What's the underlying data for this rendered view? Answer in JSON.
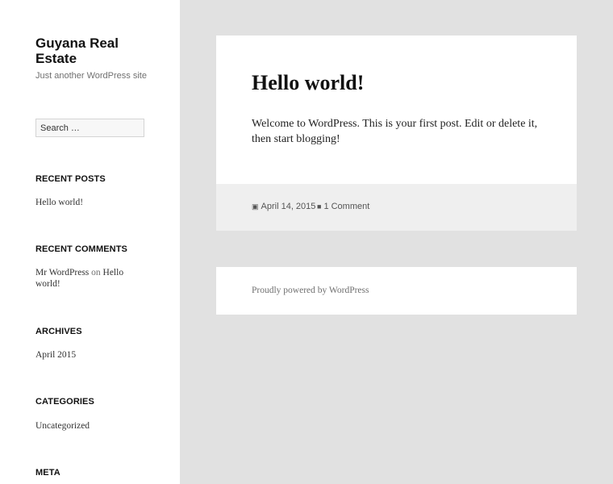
{
  "site": {
    "title": "Guyana Real Estate",
    "description": "Just another WordPress site"
  },
  "search": {
    "placeholder": "Search …"
  },
  "widgets": {
    "recent_posts": {
      "title": "RECENT POSTS",
      "items": [
        "Hello world!"
      ]
    },
    "recent_comments": {
      "title": "RECENT COMMENTS",
      "author": "Mr WordPress",
      "on": "on",
      "post": "Hello world!"
    },
    "archives": {
      "title": "ARCHIVES",
      "items": [
        "April 2015"
      ]
    },
    "categories": {
      "title": "CATEGORIES",
      "items": [
        "Uncategorized"
      ]
    },
    "meta": {
      "title": "META"
    }
  },
  "post": {
    "title": "Hello world!",
    "content": "Welcome to WordPress. This is your first post. Edit or delete it, then start blogging!",
    "date": "April 14, 2015",
    "comments": "1 Comment",
    "date_icon": "calendar-icon",
    "comment_icon": "comment-icon"
  },
  "footer": {
    "credit": "Proudly powered by WordPress"
  }
}
